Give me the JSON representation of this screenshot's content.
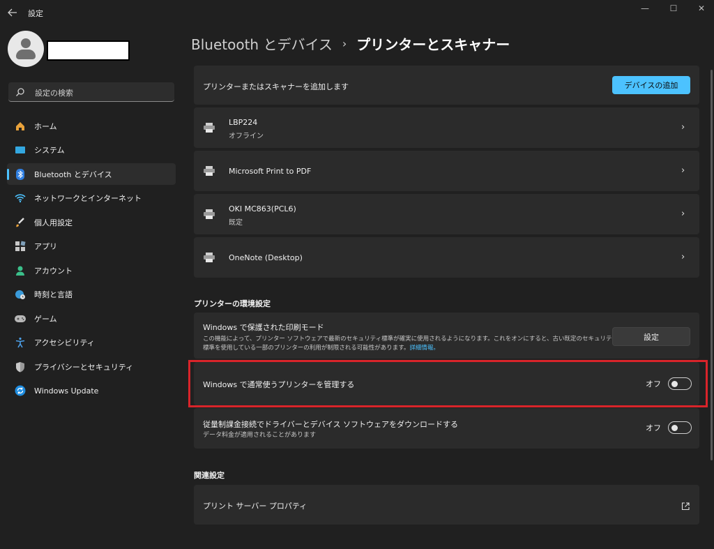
{
  "window": {
    "title": "設定",
    "back_icon": "back-arrow-icon",
    "controls": [
      "—",
      "☐",
      "✕"
    ]
  },
  "user": {
    "name": ""
  },
  "search": {
    "placeholder": "設定の検索"
  },
  "nav": {
    "items": [
      {
        "label": "ホーム",
        "icon": "home-icon"
      },
      {
        "label": "システム",
        "icon": "system-icon"
      },
      {
        "label": "Bluetooth とデバイス",
        "icon": "bluetooth-icon",
        "active": true
      },
      {
        "label": "ネットワークとインターネット",
        "icon": "wifi-icon"
      },
      {
        "label": "個人用設定",
        "icon": "brush-icon"
      },
      {
        "label": "アプリ",
        "icon": "apps-icon"
      },
      {
        "label": "アカウント",
        "icon": "account-icon"
      },
      {
        "label": "時刻と言語",
        "icon": "globe-clock-icon"
      },
      {
        "label": "ゲーム",
        "icon": "gamepad-icon"
      },
      {
        "label": "アクセシビリティ",
        "icon": "accessibility-icon"
      },
      {
        "label": "プライバシーとセキュリティ",
        "icon": "shield-icon"
      },
      {
        "label": "Windows Update",
        "icon": "update-icon"
      }
    ]
  },
  "breadcrumb": {
    "parent": "Bluetooth とデバイス",
    "separator": "›",
    "current": "プリンターとスキャナー"
  },
  "add_device": {
    "label": "プリンターまたはスキャナーを追加します",
    "button": "デバイスの追加"
  },
  "printers": [
    {
      "name": "LBP224",
      "status": "オフライン"
    },
    {
      "name": "Microsoft Print to PDF",
      "status": ""
    },
    {
      "name": "OKI MC863(PCL6)",
      "status": "既定"
    },
    {
      "name": "OneNote (Desktop)",
      "status": ""
    }
  ],
  "preferences": {
    "title": "プリンターの環境設定",
    "protected_mode": {
      "title": "Windows で保護された印刷モード",
      "description_line1": "この機能によって、プリンター ソフトウェアで最新のセキュリティ標準が確実に使用されるようになります。これをオンにすると、古い既定のセキュリティ",
      "description_line2": "標準を使用している一部のプリンターの利用が制限される可能性があります。",
      "link": "詳細情報。",
      "button": "設定"
    },
    "manage_default": {
      "title": "Windows で通常使うプリンターを管理する",
      "toggle_label": "オフ",
      "on": false
    },
    "metered_download": {
      "title": "従量制課金接続でドライバーとデバイス ソフトウェアをダウンロードする",
      "subtitle": "データ料金が適用されることがあります",
      "toggle_label": "オフ",
      "on": false
    }
  },
  "related": {
    "title": "関連設定",
    "print_server": "プリント サーバー プロパティ"
  },
  "colors": {
    "accent": "#4cc2ff",
    "background": "#202020",
    "card": "#2b2b2b",
    "highlight": "#d9242a"
  }
}
